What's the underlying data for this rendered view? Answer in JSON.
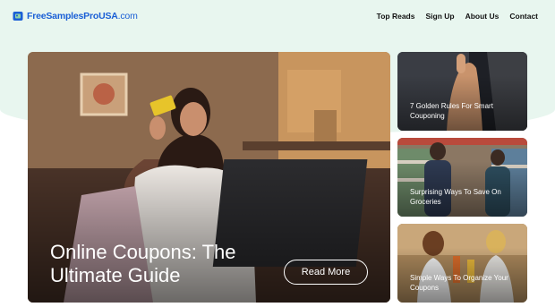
{
  "site": {
    "logo_main": "FreeSamplesProUSA",
    "logo_suffix": ".com"
  },
  "nav": {
    "items": [
      "Top Reads",
      "Sign Up",
      "About Us",
      "Contact"
    ]
  },
  "hero": {
    "title": "Online Coupons: The Ultimate Guide",
    "button_label": "Read More"
  },
  "cards": [
    {
      "title": "7 Golden Rules For Smart Couponing"
    },
    {
      "title": "Surprising Ways To Save On Groceries"
    },
    {
      "title": "Simple Ways To Organize Your Coupons"
    }
  ],
  "colors": {
    "brand": "#1a5fd6",
    "background_band": "#e8f6ef",
    "nav_text": "#121212"
  }
}
